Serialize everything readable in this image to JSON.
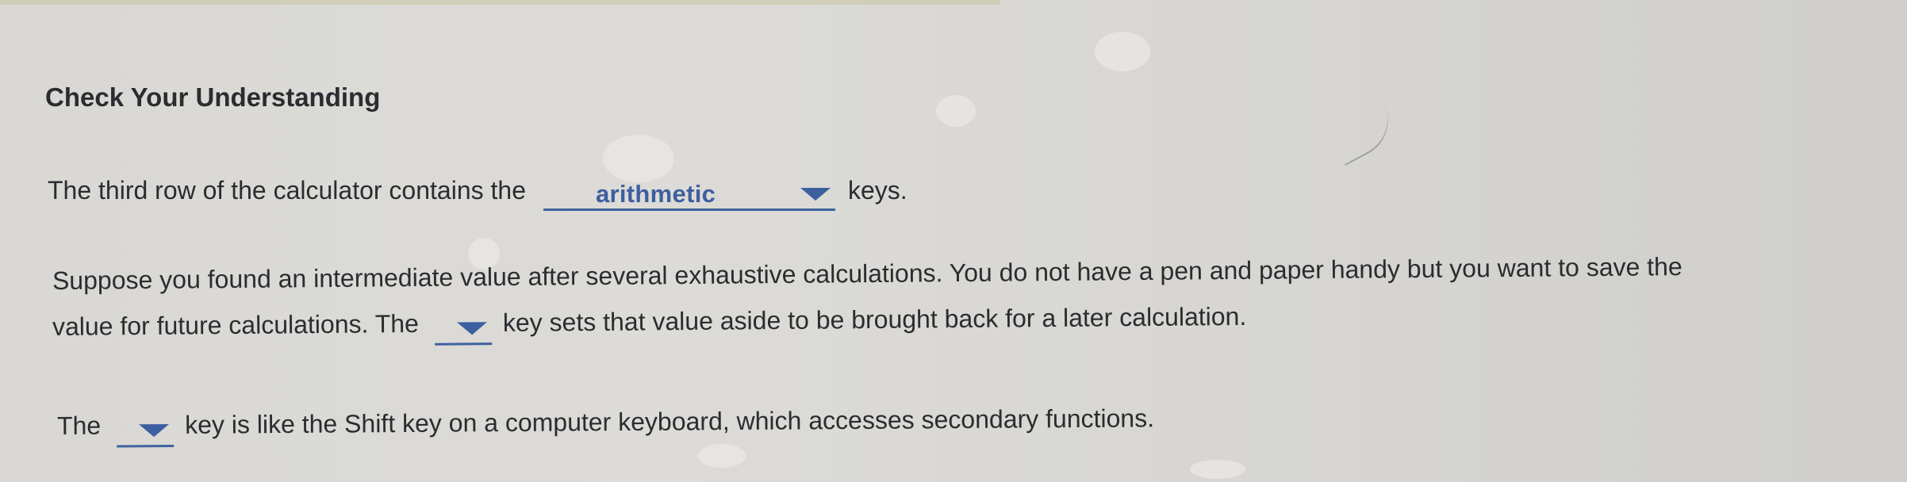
{
  "heading": "Check Your Understanding",
  "question1": {
    "before": "The third row of the calculator contains the",
    "dropdown_value": "arithmetic",
    "after": "keys."
  },
  "question2": {
    "line1": "Suppose you found an intermediate value after several exhaustive calculations. You do not have a pen and paper handy but you want to save the",
    "line2_before": "value for future calculations. The",
    "dropdown_value": "",
    "line2_after": "key sets that value aside to be brought back for a later calculation."
  },
  "question3": {
    "before": "The",
    "dropdown_value": "",
    "after": "key is like the Shift key on a computer keyboard, which accesses secondary functions."
  },
  "icons": {
    "dropdown_caret": "chevron-down-icon"
  },
  "colors": {
    "accent": "#3d5f9f",
    "text": "#2c2c30",
    "background": "#d9d8d5"
  }
}
